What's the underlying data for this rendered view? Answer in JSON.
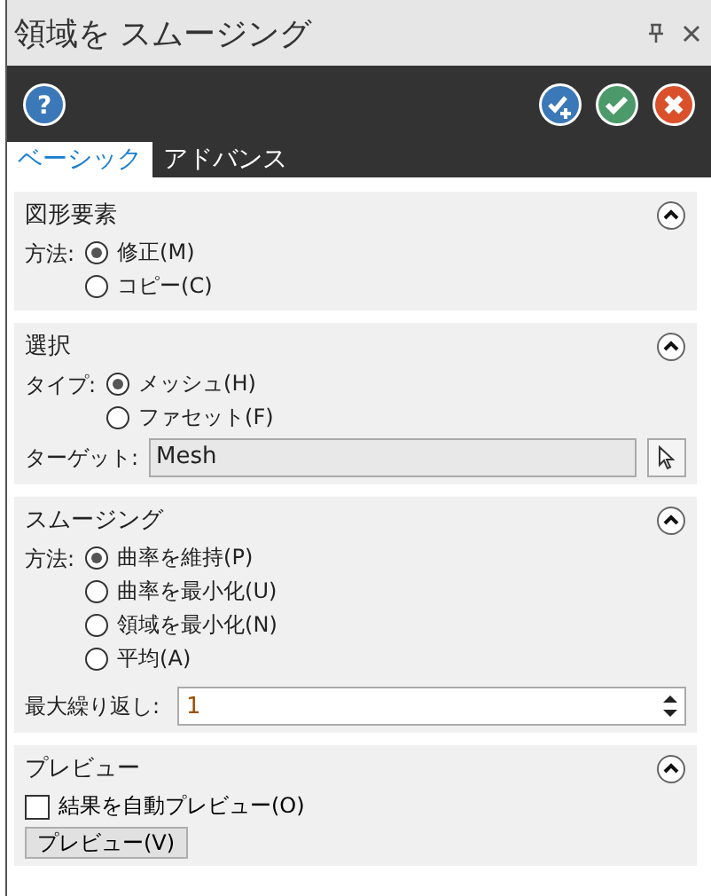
{
  "window": {
    "title": "領域を スムージング",
    "help": "?"
  },
  "tabs": [
    {
      "label": "ベーシック",
      "selected": true
    },
    {
      "label": "アドバンス",
      "selected": false
    }
  ],
  "sections": [
    {
      "title": "図形要素",
      "expanded": true,
      "rows": [
        {
          "kind": "radio",
          "label": "方法:",
          "options": [
            {
              "label": "修正(M)",
              "selected": true
            },
            {
              "label": "コピー(C)",
              "selected": false
            }
          ]
        }
      ]
    },
    {
      "title": "選択",
      "expanded": true,
      "rows": [
        {
          "kind": "radio",
          "label": "タイプ:",
          "options": [
            {
              "label": "メッシュ(H)",
              "selected": true
            },
            {
              "label": "ファセット(F)",
              "selected": false
            }
          ]
        },
        {
          "kind": "target",
          "label": "ターゲット:",
          "value": "Mesh"
        }
      ]
    },
    {
      "title": "スムージング",
      "expanded": true,
      "rows": [
        {
          "kind": "radio",
          "label": "方法:",
          "options": [
            {
              "label": "曲率を維持(P)",
              "selected": true
            },
            {
              "label": "曲率を最小化(U)",
              "selected": false
            },
            {
              "label": "領域を最小化(N)",
              "selected": false
            },
            {
              "label": "平均(A)",
              "selected": false
            }
          ]
        },
        {
          "kind": "spin",
          "label": "最大繰り返し:",
          "value": "1"
        }
      ]
    },
    {
      "title": "プレビュー",
      "expanded": true,
      "rows": [
        {
          "kind": "checkbox",
          "label": "結果を自動プレビュー(O)",
          "checked": false
        },
        {
          "kind": "button",
          "label": "プレビュー(V)"
        }
      ]
    }
  ]
}
